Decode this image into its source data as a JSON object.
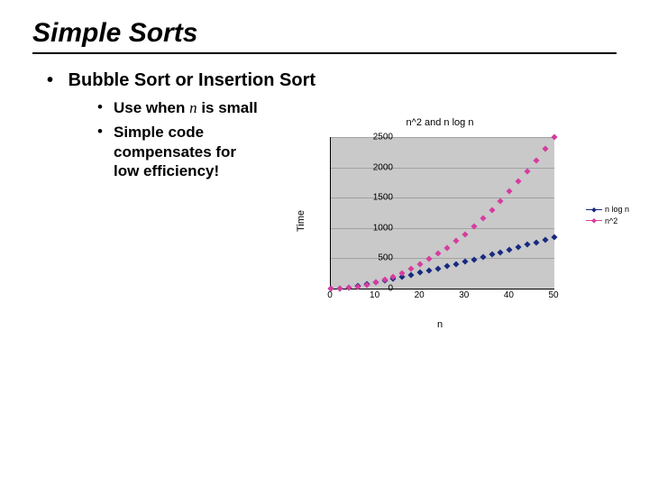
{
  "title": "Simple Sorts",
  "main_bullet": "Bubble Sort or Insertion Sort",
  "sub_bullet_1_pre": "Use when ",
  "sub_bullet_1_var": "n",
  "sub_bullet_1_post": " is small",
  "sub_bullet_2": "Simple code compensates for low efficiency!",
  "chart_data": {
    "type": "scatter",
    "title": "n^2 and n log n",
    "xlabel": "n",
    "ylabel": "Time",
    "xlim": [
      0,
      50
    ],
    "ylim": [
      0,
      2500
    ],
    "x_ticks": [
      0,
      10,
      20,
      30,
      40,
      50
    ],
    "y_ticks": [
      0,
      500,
      1000,
      1500,
      2000,
      2500
    ],
    "x": [
      0,
      2,
      4,
      6,
      8,
      10,
      12,
      14,
      16,
      18,
      20,
      22,
      24,
      26,
      28,
      30,
      32,
      34,
      36,
      38,
      40,
      42,
      44,
      46,
      48,
      50
    ],
    "series": [
      {
        "name": "n log n",
        "color": "#172a80",
        "values": [
          0,
          6,
          22,
          45,
          72,
          100,
          130,
          162,
          194,
          228,
          262,
          297,
          333,
          370,
          407,
          445,
          483,
          522,
          561,
          601,
          641,
          682,
          723,
          764,
          806,
          848
        ]
      },
      {
        "name": "n^2",
        "color": "#d63ca0",
        "values": [
          0,
          4,
          16,
          36,
          64,
          100,
          144,
          196,
          256,
          324,
          400,
          484,
          576,
          676,
          784,
          900,
          1024,
          1156,
          1296,
          1444,
          1600,
          1764,
          1936,
          2116,
          2304,
          2500
        ]
      }
    ],
    "legend": [
      "n log n",
      "n^2"
    ]
  }
}
